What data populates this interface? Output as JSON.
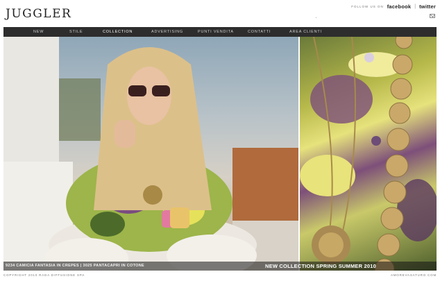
{
  "header": {
    "logo": "JUGGLER",
    "follow_label": "FOLLOW US ON",
    "facebook": "facebook",
    "separator": "|",
    "twitter": "twitter"
  },
  "nav": {
    "items": [
      {
        "label": "NEW",
        "active": false
      },
      {
        "label": "STILE",
        "active": false
      },
      {
        "label": "COLLECTION",
        "active": true
      },
      {
        "label": "ADVERTISING",
        "active": false
      },
      {
        "label": "PUNTI VENDITA",
        "active": false
      },
      {
        "label": "CONTATTI",
        "active": false
      },
      {
        "label": "AREA CLIENTI",
        "active": false
      }
    ]
  },
  "photo": {
    "caption_left": "9234 CAMICIA FANTASIA IN CREPES | 3025 PANTACAPRI IN COTONE",
    "caption_right": "NEW COLLECTION SPRING SUMMER 2010"
  },
  "footer": {
    "copyright": "COPYRIGHT 2010 RADA DIFFUSIONE SPA",
    "credit": "AMOREVASATURO.COM"
  },
  "colors": {
    "navbar": "#2d2d2d",
    "nav_text": "#d0d0d0",
    "logo": "#222222",
    "footer_text": "#777777"
  }
}
